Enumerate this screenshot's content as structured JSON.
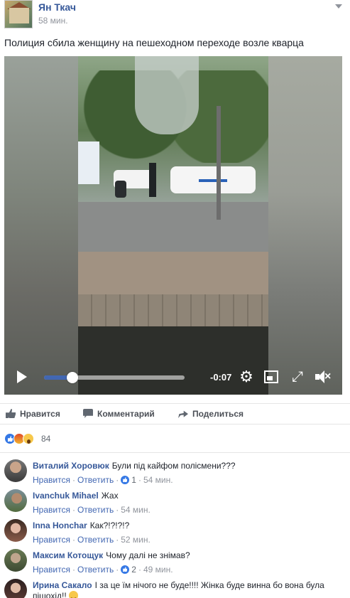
{
  "post": {
    "author": "Ян Ткач",
    "time": "58 мин.",
    "text": "Полиция сбила женщину на пешеходном переходе возле кварца"
  },
  "video": {
    "time_remaining": "-0:07",
    "progress": 0.2
  },
  "actions": {
    "like": "Нравится",
    "comment": "Комментарий",
    "share": "Поделиться"
  },
  "reactions": {
    "types": [
      "like",
      "angry",
      "wow"
    ],
    "count": "84"
  },
  "comments": [
    {
      "author": "Виталий Хоровюк",
      "text": "Були під кайфом полісмени???",
      "like": "Нравится",
      "reply": "Ответить",
      "likes": "1",
      "time": "54 мин."
    },
    {
      "author": "Ivanchuk Mihael",
      "text": "Жах",
      "like": "Нравится",
      "reply": "Ответить",
      "time": "54 мин."
    },
    {
      "author": "Inna Honchar",
      "text": "Как?!?!?!?",
      "like": "Нравится",
      "reply": "Ответить",
      "time": "52 мин."
    },
    {
      "author": "Максим Котощук",
      "text": "Чому далі не знімав?",
      "like": "Нравится",
      "reply": "Ответить",
      "likes": "2",
      "time": "49 мин."
    },
    {
      "author": "Ирина Сакало",
      "text": "І за це їм нічого не буде!!!! Жінка буде винна бо вона була пішохід!!"
    }
  ],
  "colors": {
    "link": "#365899",
    "accent": "#4267b2",
    "like_blue": "#3578e5"
  }
}
